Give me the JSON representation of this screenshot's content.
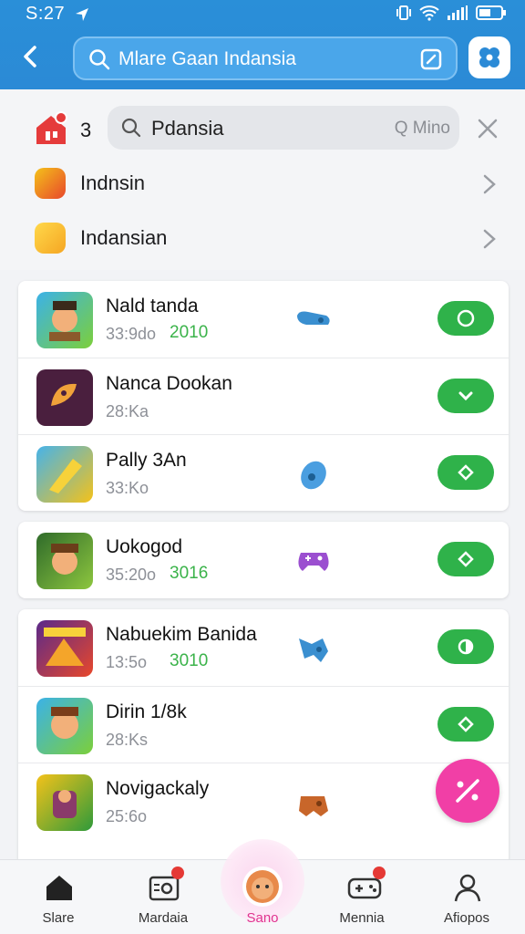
{
  "status": {
    "time": "S:27"
  },
  "header": {
    "search_text": "Mlare Gaan Indansia"
  },
  "filter": {
    "count": "3",
    "search_value": "Pdansia",
    "mode": "Q Mino",
    "suggestions": [
      {
        "label": "Indnsin"
      },
      {
        "label": "Indansian"
      }
    ]
  },
  "cards": [
    {
      "rows": [
        {
          "name": "Nald tanda",
          "meta": "33:9do",
          "year": "2010",
          "mid_icon": "controller-icon"
        },
        {
          "name": "Nanca Dookan",
          "meta": "28:Ka",
          "year": "",
          "mid_icon": ""
        },
        {
          "name": "Pally 3An",
          "meta": "33:Ko",
          "year": "",
          "mid_icon": "gamepad-icon"
        }
      ]
    },
    {
      "rows": [
        {
          "name": "Uokogod",
          "meta": "35:20o",
          "year": "3016",
          "mid_icon": "gamepad-icon"
        }
      ]
    },
    {
      "rows": [
        {
          "name": "Nabuekim Banida",
          "meta": "13:5o",
          "year": "3010",
          "mid_icon": "gamepad-icon"
        },
        {
          "name": "Dirin 1/8k",
          "meta": "28:Ks",
          "year": "",
          "mid_icon": ""
        },
        {
          "name": "Novigackaly",
          "meta": "25:6o",
          "year": "",
          "mid_icon": "gamepad-icon"
        }
      ]
    }
  ],
  "bottom_nav": [
    {
      "label": "Slare"
    },
    {
      "label": "Mardaia"
    },
    {
      "label": "Sano"
    },
    {
      "label": "Mennia"
    },
    {
      "label": "Afiopos"
    }
  ],
  "colors": {
    "header": "#2b8ad6",
    "accent_green": "#2fb24a",
    "fab": "#f13fa6",
    "active_nav": "#e0338f"
  }
}
